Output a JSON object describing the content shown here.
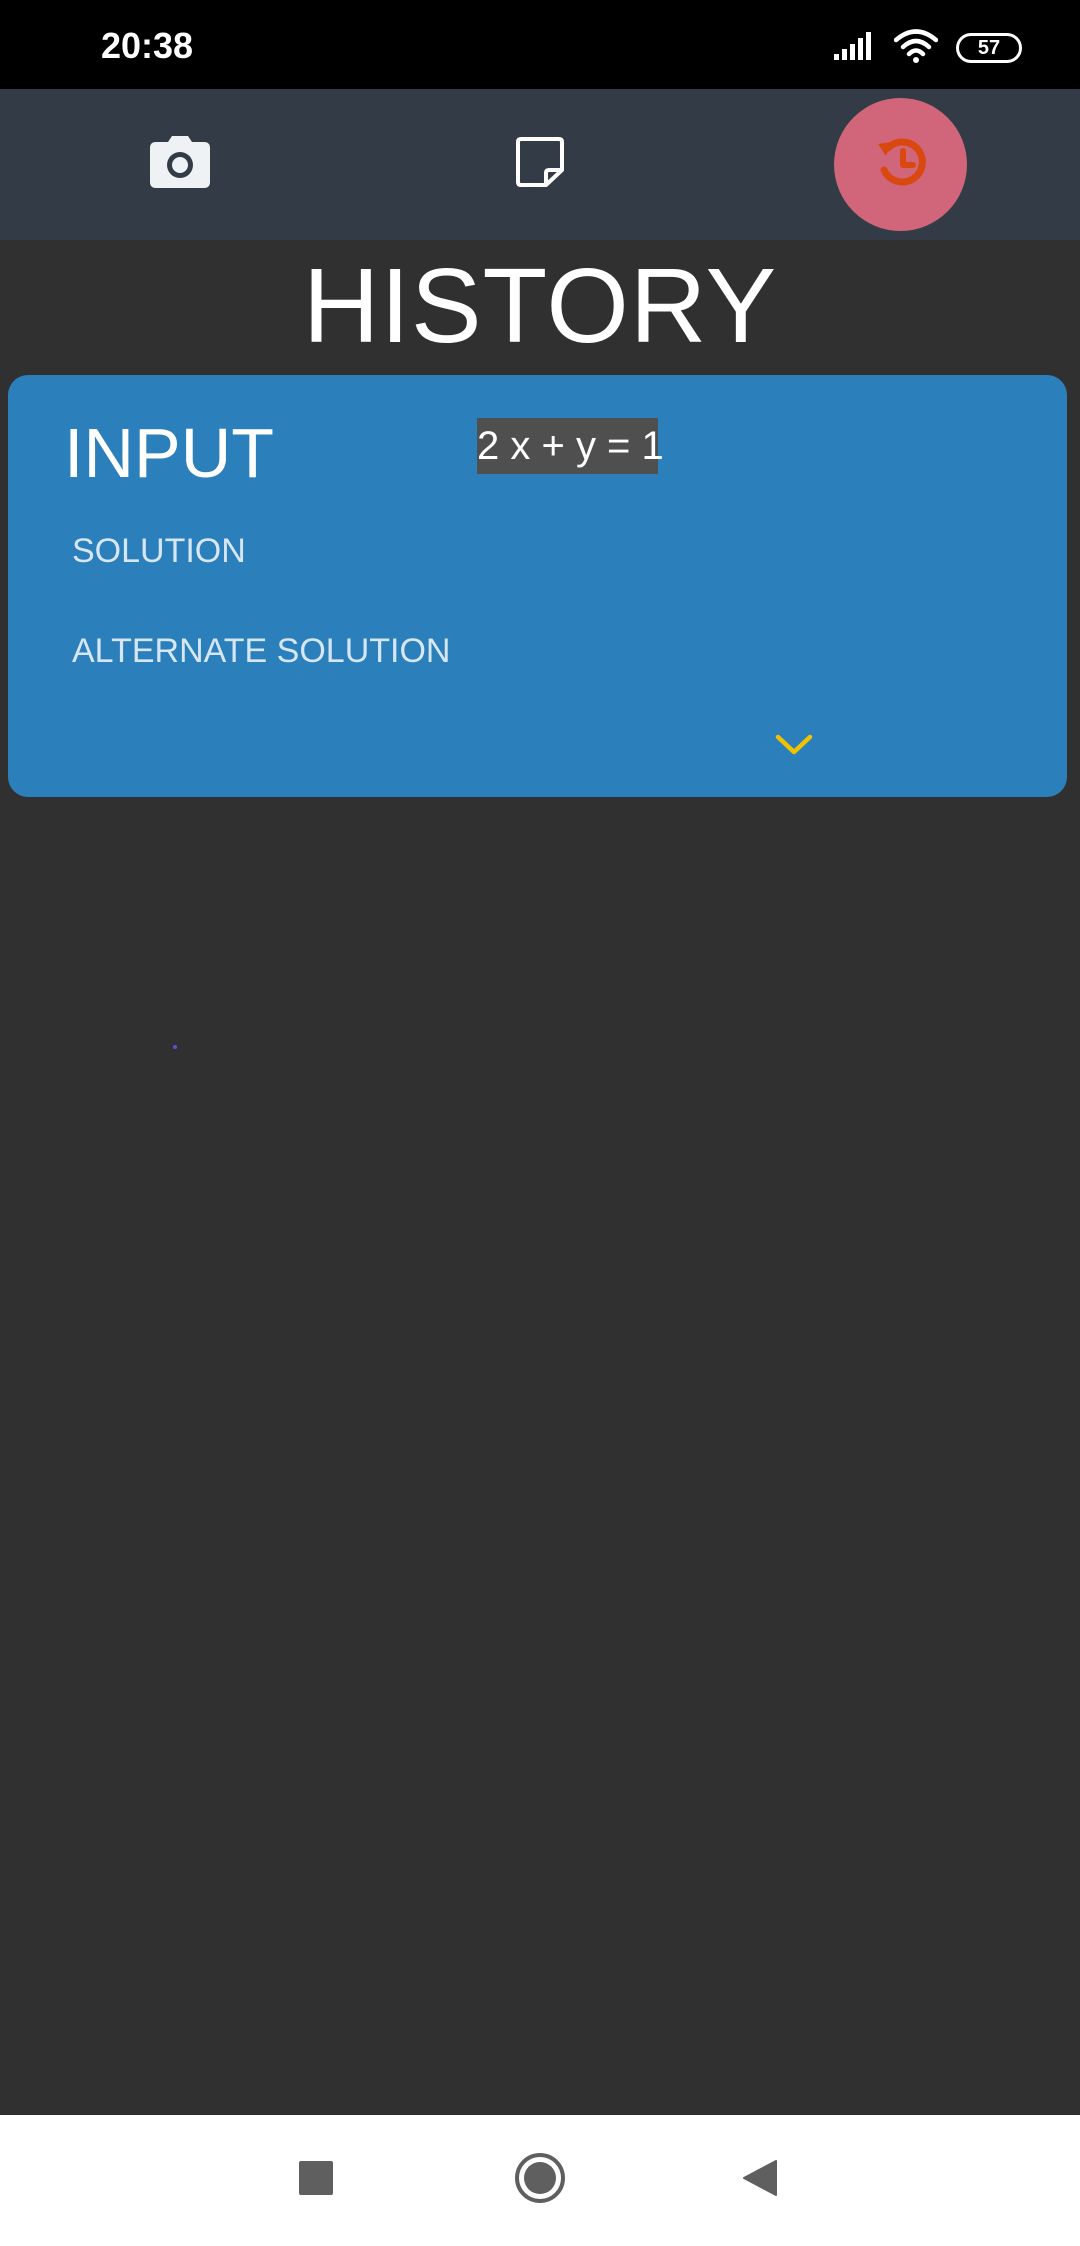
{
  "status_bar": {
    "time": "20:38",
    "battery": "57",
    "icons": [
      "signal-icon",
      "wifi-icon",
      "battery-icon"
    ]
  },
  "tabs": [
    {
      "id": "camera",
      "icon": "camera-icon",
      "active": false
    },
    {
      "id": "note",
      "icon": "note-icon",
      "active": false
    },
    {
      "id": "history",
      "icon": "history-icon",
      "active": true
    }
  ],
  "page": {
    "title": "HISTORY"
  },
  "history_card": {
    "input_label": "INPUT",
    "equation": "2 x + y = 1",
    "solution_label": "SOLUTION",
    "alternate_solution_label": "ALTERNATE SOLUTION",
    "expand_icon": "chevron-down-icon"
  },
  "nav_bar": {
    "buttons": [
      "recents-icon",
      "home-icon",
      "back-icon"
    ]
  },
  "colors": {
    "background": "#303030",
    "tab_bar": "#333b46",
    "active_tab": "#d1667a",
    "active_icon": "#d9480f",
    "card": "#2b7fba",
    "equation_bg": "#4f4f4f",
    "chevron": "#f2c200"
  }
}
